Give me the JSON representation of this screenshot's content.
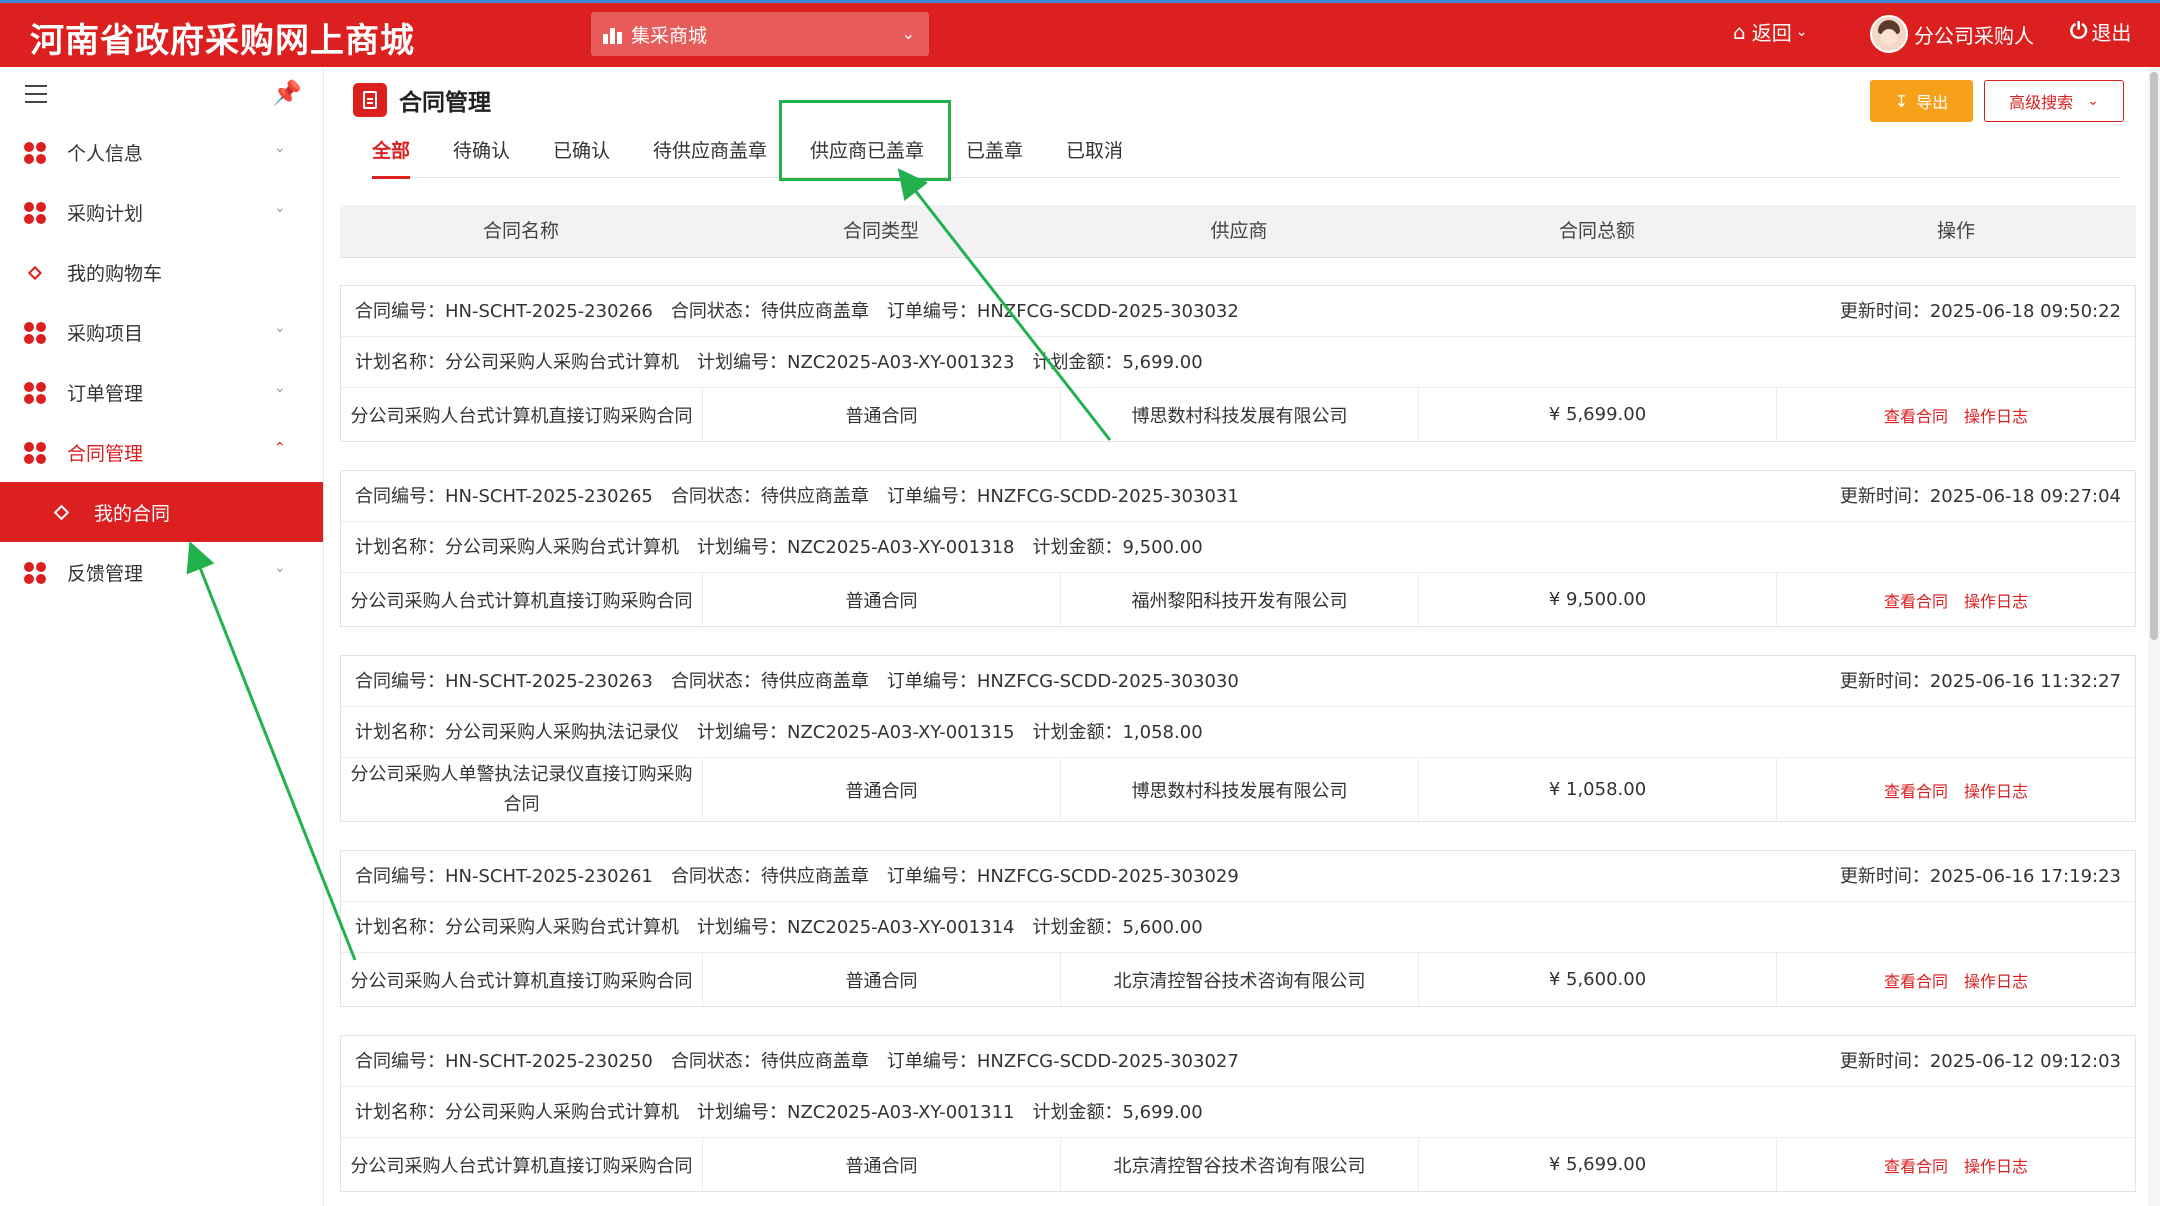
{
  "header": {
    "site_title": "河南省政府采购网上商城",
    "mall_select": "集采商城",
    "back": "返回",
    "user": "分公司采购人",
    "logout": "退出"
  },
  "sidebar": {
    "items": [
      {
        "label": "个人信息"
      },
      {
        "label": "采购计划"
      },
      {
        "label": "我的购物车"
      },
      {
        "label": "采购项目"
      },
      {
        "label": "订单管理"
      },
      {
        "label": "合同管理"
      },
      {
        "label": "我的合同"
      },
      {
        "label": "反馈管理"
      }
    ]
  },
  "page": {
    "title": "合同管理",
    "export": "导出",
    "advanced_search": "高级搜索"
  },
  "tabs": [
    "全部",
    "待确认",
    "已确认",
    "待供应商盖章",
    "供应商已盖章",
    "已盖章",
    "已取消"
  ],
  "table": {
    "headers": [
      "合同名称",
      "合同类型",
      "供应商",
      "合同总额",
      "操作"
    ],
    "view_contract": "查看合同",
    "operation_log": "操作日志"
  },
  "contracts": [
    {
      "meta": "合同编号：HN-SCHT-2025-230266　合同状态：待供应商盖章　订单编号：HNZFCG-SCDD-2025-303032",
      "updated": "更新时间：2025-06-18 09:50:22",
      "plan": "计划名称：分公司采购人采购台式计算机　计划编号：NZC2025-A03-XY-001323　计划金额：5,699.00",
      "name": "分公司采购人台式计算机直接订购采购合同",
      "type": "普通合同",
      "supplier": "博思数村科技发展有限公司",
      "amount": "¥ 5,699.00"
    },
    {
      "meta": "合同编号：HN-SCHT-2025-230265　合同状态：待供应商盖章　订单编号：HNZFCG-SCDD-2025-303031",
      "updated": "更新时间：2025-06-18 09:27:04",
      "plan": "计划名称：分公司采购人采购台式计算机　计划编号：NZC2025-A03-XY-001318　计划金额：9,500.00",
      "name": "分公司采购人台式计算机直接订购采购合同",
      "type": "普通合同",
      "supplier": "福州黎阳科技开发有限公司",
      "amount": "¥ 9,500.00"
    },
    {
      "meta": "合同编号：HN-SCHT-2025-230263　合同状态：待供应商盖章　订单编号：HNZFCG-SCDD-2025-303030",
      "updated": "更新时间：2025-06-16 11:32:27",
      "plan": "计划名称：分公司采购人采购执法记录仪　计划编号：NZC2025-A03-XY-001315　计划金额：1,058.00",
      "name": "分公司采购人单警执法记录仪直接订购采购合同",
      "type": "普通合同",
      "supplier": "博思数村科技发展有限公司",
      "amount": "¥ 1,058.00"
    },
    {
      "meta": "合同编号：HN-SCHT-2025-230261　合同状态：待供应商盖章　订单编号：HNZFCG-SCDD-2025-303029",
      "updated": "更新时间：2025-06-16 17:19:23",
      "plan": "计划名称：分公司采购人采购台式计算机　计划编号：NZC2025-A03-XY-001314　计划金额：5,600.00",
      "name": "分公司采购人台式计算机直接订购采购合同",
      "type": "普通合同",
      "supplier": "北京清控智谷技术咨询有限公司",
      "amount": "¥ 5,600.00"
    },
    {
      "meta": "合同编号：HN-SCHT-2025-230250　合同状态：待供应商盖章　订单编号：HNZFCG-SCDD-2025-303027",
      "updated": "更新时间：2025-06-12 09:12:03",
      "plan": "计划名称：分公司采购人采购台式计算机　计划编号：NZC2025-A03-XY-001311　计划金额：5,699.00",
      "name": "分公司采购人台式计算机直接订购采购合同",
      "type": "普通合同",
      "supplier": "北京清控智谷技术咨询有限公司",
      "amount": "¥ 5,699.00"
    }
  ]
}
